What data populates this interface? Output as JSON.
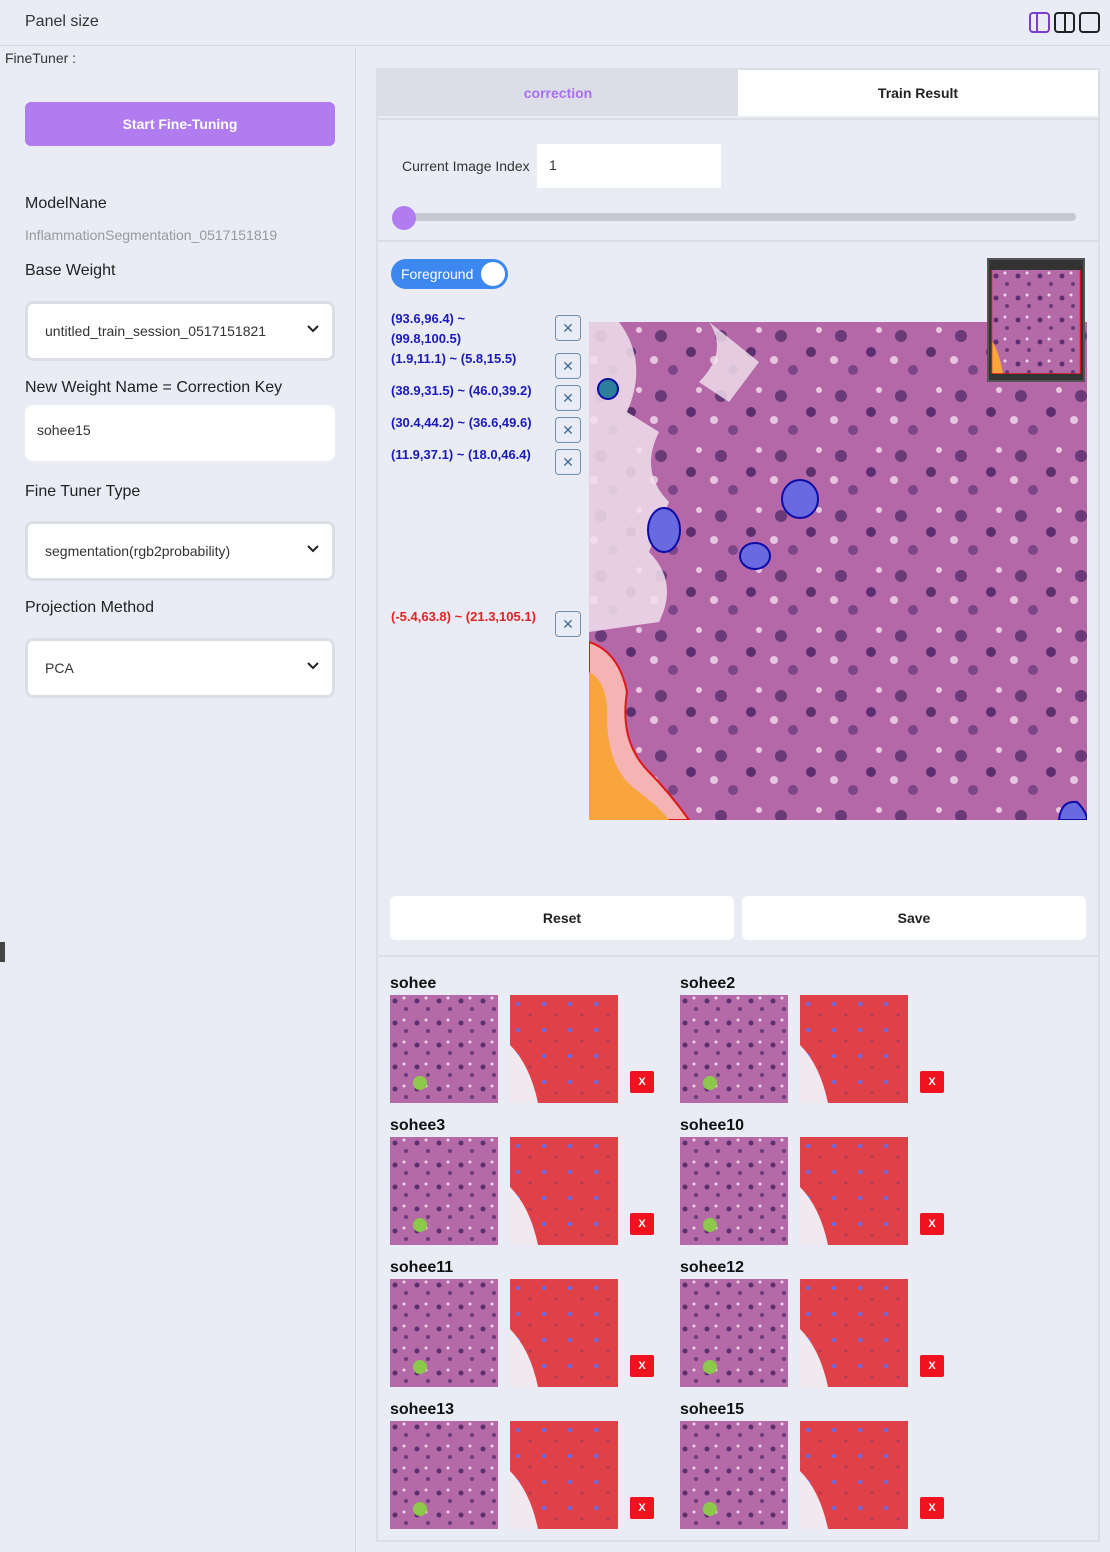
{
  "topbar": {
    "title": "Panel size"
  },
  "left": {
    "finetuner_label": "FineTuner :",
    "start_button": "Start Fine-Tuning",
    "model_name_label": "ModelNane",
    "model_name_value": "InflammationSegmentation_0517151819",
    "base_weight_label": "Base Weight",
    "base_weight_value": "untitled_train_session_0517151821",
    "new_weight_label": "New Weight Name = Correction Key",
    "new_weight_value": "sohee15",
    "tuner_type_label": "Fine Tuner Type",
    "tuner_type_value": "segmentation(rgb2probability)",
    "projection_label": "Projection Method",
    "projection_value": "PCA"
  },
  "tabs": {
    "correction": "correction",
    "train_result": "Train Result"
  },
  "index": {
    "label": "Current Image Index",
    "value": "1",
    "slider_value": 1
  },
  "toggle": {
    "label": "Foreground"
  },
  "coords": [
    {
      "text": "(93.6,96.4) ~",
      "text2": "(99.8,100.5)",
      "color": "blue"
    },
    {
      "text": "(1.9,11.1) ~ (5.8,15.5)",
      "color": "blue"
    },
    {
      "text": "(38.9,31.5) ~ (46.0,39.2)",
      "color": "blue"
    },
    {
      "text": "(30.4,44.2) ~ (36.6,49.6)",
      "color": "blue"
    },
    {
      "text": "(11.9,37.1) ~ (18.0,46.4)",
      "color": "blue"
    },
    {
      "text": "(-5.4,63.8) ~ (21.3,105.1)",
      "color": "red"
    }
  ],
  "actions": {
    "reset": "Reset",
    "save": "Save"
  },
  "gallery": [
    {
      "name": "sohee",
      "delete": "X"
    },
    {
      "name": "sohee2",
      "delete": "X"
    },
    {
      "name": "sohee3",
      "delete": "X"
    },
    {
      "name": "sohee10",
      "delete": "X"
    },
    {
      "name": "sohee11",
      "delete": "X"
    },
    {
      "name": "sohee12",
      "delete": "X"
    },
    {
      "name": "sohee13",
      "delete": "X"
    },
    {
      "name": "sohee15",
      "delete": "X"
    }
  ],
  "colors": {
    "accent": "#b07cf0",
    "toggle": "#3d87f0",
    "delete": "#f0131e"
  }
}
